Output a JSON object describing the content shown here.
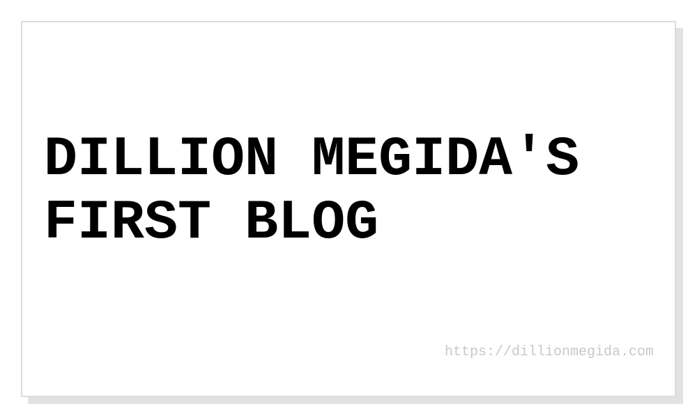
{
  "card": {
    "title": "DILLION MEGIDA'S FIRST BLOG",
    "url": "https://dillionmegida.com"
  },
  "colors": {
    "background": "#ffffff",
    "card_border": "#dcdcdc",
    "shadow": "#e2e2e2",
    "title_text": "#000000",
    "url_text": "#c8c8c8"
  }
}
